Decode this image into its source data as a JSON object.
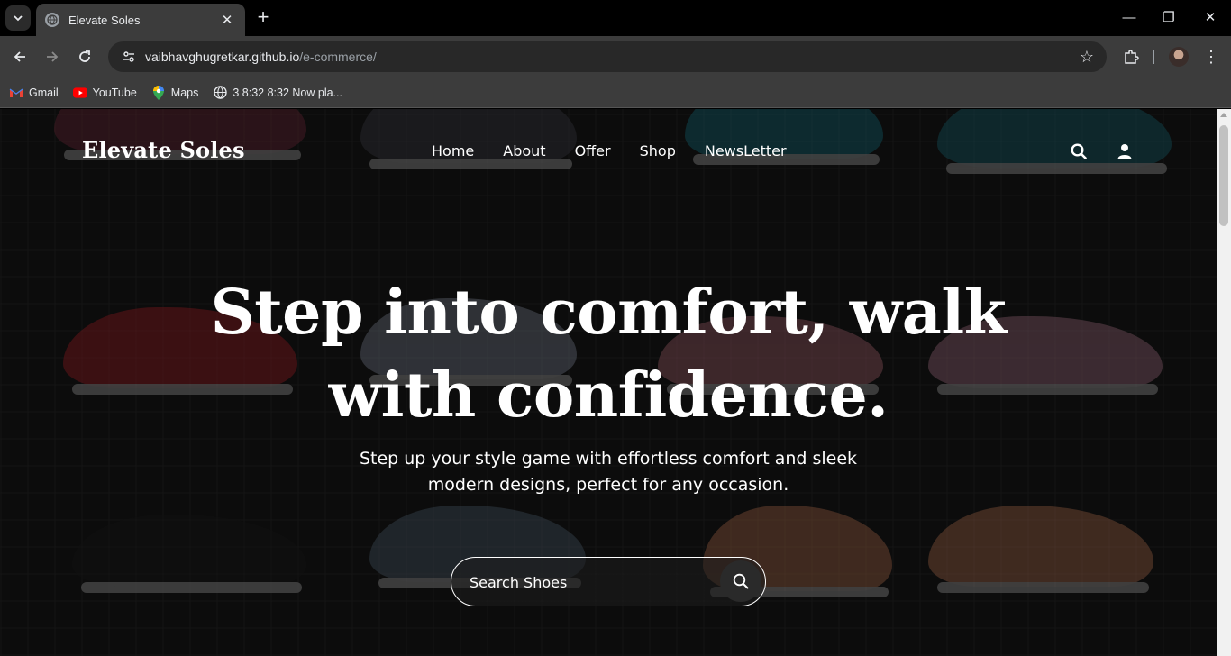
{
  "browser": {
    "tab_title": "Elevate Soles",
    "new_tab_symbol": "+",
    "close_symbol": "✕",
    "url_host": "vaibhavghugretkar.github.io",
    "url_path": "/e-commerce/",
    "bookmarks": [
      {
        "label": "Gmail",
        "icon": "gmail-icon"
      },
      {
        "label": "YouTube",
        "icon": "youtube-icon"
      },
      {
        "label": "Maps",
        "icon": "maps-icon"
      },
      {
        "label": "3 8:32 8:32 Now pla...",
        "icon": "globe-icon"
      }
    ],
    "window_controls": {
      "minimize": "—",
      "restore": "❐",
      "close": "✕"
    }
  },
  "site": {
    "brand": "Elevate Soles",
    "nav": [
      "Home",
      "About",
      "Offer",
      "Shop",
      "NewsLetter"
    ],
    "header_icons": [
      "search-icon",
      "user-icon"
    ]
  },
  "hero": {
    "title": "Step into comfort, walk with confidence.",
    "subtitle": "Step up your style game with effortless comfort and sleek modern designs, perfect for any occasion.",
    "search_placeholder": "Search Shoes"
  },
  "colors": {
    "chrome_dark": "#000000",
    "chrome_bar": "#3c3c3c",
    "text_light": "#ffffff"
  }
}
